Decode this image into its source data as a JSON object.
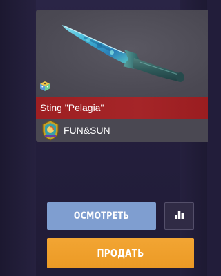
{
  "item": {
    "name": "Sting \"Pelagia\"",
    "collection": "FUN&SUN",
    "rarity_color": "#a52528",
    "tier_icon": "dice-icon",
    "collection_icon": "fun-and-sun-logo"
  },
  "actions": {
    "inspect_label": "ОСМОТРЕТЬ",
    "stats_icon": "bar-chart-icon",
    "sell_label": "ПРОДАТЬ"
  },
  "colors": {
    "background": "#221d3a",
    "inspect_button": "#7f9ed0",
    "sell_button": "#ee9d2a",
    "card": "#4d4b55"
  }
}
